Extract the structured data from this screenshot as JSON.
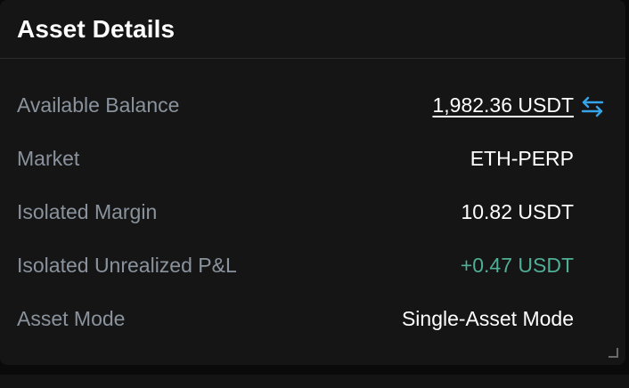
{
  "panel": {
    "title": "Asset Details"
  },
  "rows": [
    {
      "label": "Available Balance",
      "value": "1,982.36 USDT"
    },
    {
      "label": "Market",
      "value": "ETH-PERP"
    },
    {
      "label": "Isolated Margin",
      "value": "10.82 USDT"
    },
    {
      "label": "Isolated Unrealized P&L",
      "value": "+0.47 USDT"
    },
    {
      "label": "Asset Mode",
      "value": "Single-Asset Mode"
    }
  ],
  "icons": {
    "transfer": "swap-arrows-icon",
    "resize": "resize-grip-icon"
  },
  "colors": {
    "panel_bg": "#151515",
    "label": "#8a939d",
    "value": "#ffffff",
    "positive": "#4fae95",
    "accent": "#35a4e8"
  }
}
